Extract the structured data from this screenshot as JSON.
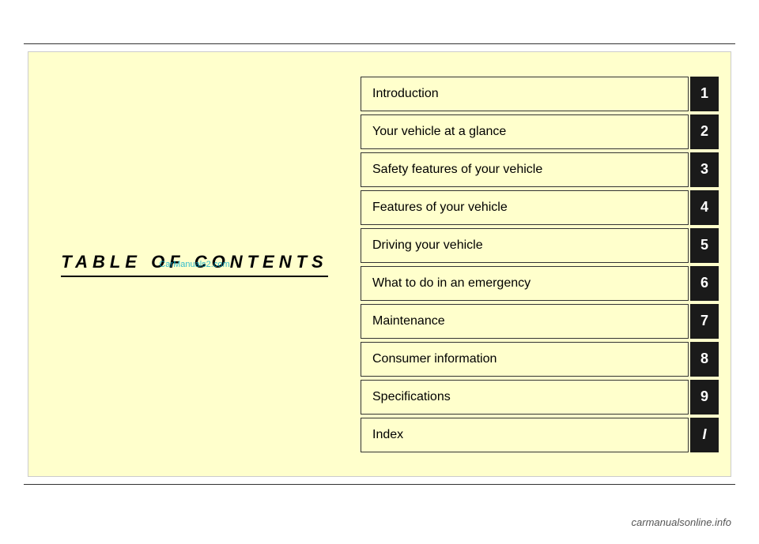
{
  "page": {
    "title": "TABLE OF CONTENTS",
    "watermark": "CarManuals2.com",
    "footer": "carmanualsonline.info"
  },
  "toc": {
    "items": [
      {
        "label": "Introduction",
        "number": "1"
      },
      {
        "label": "Your vehicle at a glance",
        "number": "2"
      },
      {
        "label": "Safety features of your vehicle",
        "number": "3"
      },
      {
        "label": "Features of your vehicle",
        "number": "4"
      },
      {
        "label": "Driving your vehicle",
        "number": "5"
      },
      {
        "label": "What to do in an emergency",
        "number": "6"
      },
      {
        "label": "Maintenance",
        "number": "7"
      },
      {
        "label": "Consumer information",
        "number": "8"
      },
      {
        "label": "Specifications",
        "number": "9"
      },
      {
        "label": "Index",
        "number": "I"
      }
    ]
  }
}
